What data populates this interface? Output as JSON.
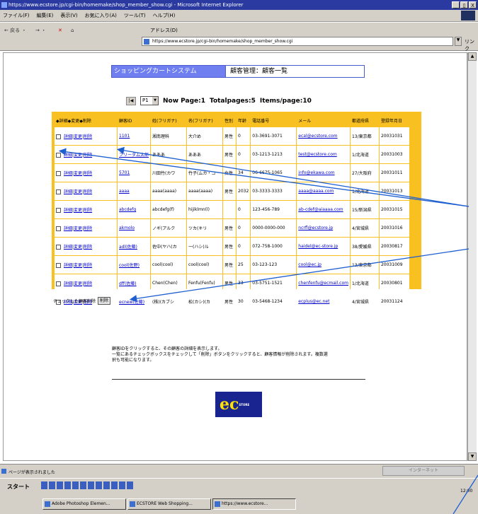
{
  "window": {
    "title": "https://www.ecstore.jp/cgi-bin/homemake/shop_member_show.cgi - Microsoft Internet Explorer",
    "controls": [
      "_",
      "▯",
      "X"
    ]
  },
  "menu": [
    "ファイル(F)",
    "編集(E)",
    "表示(V)",
    "お気に入り(A)",
    "ツール(T)",
    "ヘルプ(H)"
  ],
  "toolbar": {
    "back": "← 戻る ・",
    "forward": "→ ・",
    "stop": "✕",
    "home": "⌂",
    "address_label": "アドレス(D)",
    "address": "https://www.ecstore.jp/cgi-bin/homemake/shop_member_show.cgi",
    "go": "▼",
    "links": "リンク"
  },
  "header": {
    "system": "ショッピングカートシステム",
    "page": "顧客管理：顧客一覧"
  },
  "pager": {
    "first": "|◀",
    "page_select": "P1",
    "now_page": "Now Page:1",
    "total_pages": "Totalpages:5",
    "items_per_page": "Items/page:10"
  },
  "table": {
    "columns": [
      "◆詳細◆変更◆削除",
      "顧客ID",
      "姓(フリガナ)",
      "名(フリガナ)",
      "性別",
      "年齢",
      "電話番号",
      "メール",
      "都道府県",
      "登録年月日"
    ],
    "rows": [
      {
        "id": "1101",
        "sei": "湘南理科",
        "mei": "大介め",
        "sex": "男性",
        "age": "0",
        "tel": "03-3691-3071",
        "mail": "ecal@ecstore.com",
        "pref": "13/東京都",
        "date": "20031031"
      },
      {
        "id": "フリーダム太郎",
        "sei": "あああ",
        "mei": "あああ",
        "sex": "男性",
        "age": "0",
        "tel": "03-1213-1213",
        "mail": "test@ecstore.com",
        "pref": "1/北海道",
        "date": "20031003"
      },
      {
        "id": "5701",
        "sei": "川田竹(カワ",
        "mei": "竹子(ムカ・コ",
        "sex": "女性",
        "age": "34",
        "tel": "06-6675-1065",
        "mail": "info@ekawa.com",
        "pref": "27/大阪府",
        "date": "20031011"
      },
      {
        "id": "aaaa",
        "sei": "aaaa(aaaa)",
        "mei": "aaaa(aaaa)",
        "sex": "男性",
        "age": "2032",
        "tel": "03-3333-3333",
        "mail": "aaaa@aaaa.com",
        "pref": "1/北海道",
        "date": "20031013"
      },
      {
        "id": "abcdefg",
        "sei": "abcdefg(f)",
        "mei": "hijiklmn(l)",
        "sex": "",
        "age": "0",
        "tel": "123-456-789",
        "mail": "ab-cdef@aiaaaa.com",
        "pref": "15/新潟県",
        "date": "20031015"
      },
      {
        "id": "akmolo",
        "sei": "ノギ(アルク",
        "mei": "ツカ(キリ",
        "sex": "男性",
        "age": "0",
        "tel": "0000-0000-000",
        "mail": "ncrfl@ecstore.jp",
        "pref": "4/宮城県",
        "date": "20031016"
      },
      {
        "id": "adl(佐藤)",
        "sei": "佐中(ヤハ(カ",
        "mei": "一(ハシ)ル",
        "sex": "男性",
        "age": "0",
        "tel": "072-758-1000",
        "mail": "haidel@ec-store.jp",
        "pref": "38/愛媛県",
        "date": "20030817"
      },
      {
        "id": "cool(佐野)",
        "sei": "cool(cool)",
        "mei": "cool(cool)",
        "sex": "男性",
        "age": "25",
        "tel": "03-123-123",
        "mail": "cool@ec.jp",
        "pref": "13/東京都",
        "date": "20031009"
      },
      {
        "id": "dff(佐藤)",
        "sei": "Chen(Chen)",
        "mei": "Fenfu(Fenfu)",
        "sex": "男性",
        "age": "33",
        "tel": "03-5751-1521",
        "mail": "chenfenfu@ecmail.com",
        "pref": "1/北海道",
        "date": "20030801"
      },
      {
        "id": "ecnew(佐藤)",
        "sei": "(株)(カブシ",
        "mei": "松(カシ)(カ",
        "sex": "男性",
        "age": "30",
        "tel": "03-5468-1234",
        "mail": "ecplus@ec.net",
        "pref": "4/宮城県",
        "date": "20031124"
      }
    ],
    "actions": {
      "detail": "詳細",
      "change": "変更",
      "delete": "削除",
      "sep": "|"
    }
  },
  "bulk": {
    "label": "チェックした顧客削除",
    "button": "削除"
  },
  "notes": [
    "顧客IDをクリックすると、その顧客の詳細を表示します。",
    "一覧にあるチェックボックスをチェックして「削除」ボタンをクリックすると、顧客情報が削除されます。複数選",
    "択も可能になります。"
  ],
  "logo": {
    "main": "ec",
    "sub": "STORE"
  },
  "status": {
    "text": "ページが表示されました",
    "zone": "インターネット"
  },
  "taskbar": {
    "start": "スタート",
    "tasks": [
      "Adobe Photoshop Elemen...",
      "ECSTORE Web Shopping...",
      "https://www.ecstore..."
    ],
    "clock": "12:00"
  },
  "colors": {
    "table_bg": "#f8c020",
    "header_blue": "#6f7ff0",
    "logo_bg": "#1a2490",
    "arrow": "#1f5fd0"
  }
}
